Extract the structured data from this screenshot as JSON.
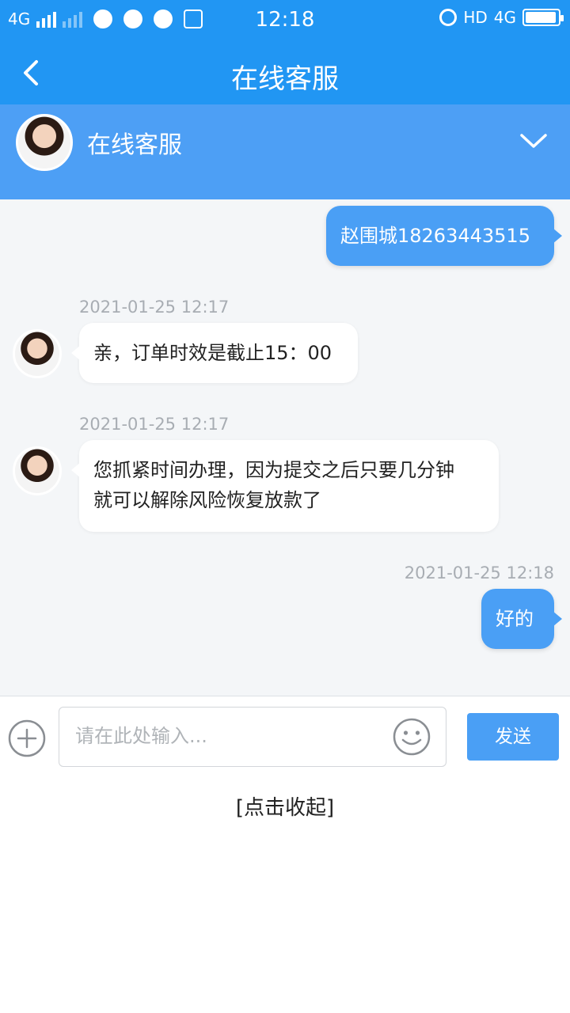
{
  "status_bar": {
    "network_left": "4G",
    "time": "12:18",
    "hd_label": "HD",
    "network_right": "4G",
    "icons": [
      "signal-icon",
      "signal-dim-icon",
      "palette-icon",
      "browser-icon",
      "chat-icon",
      "s-icon",
      "alarm-icon",
      "battery-icon"
    ]
  },
  "title_bar": {
    "title": "在线客服",
    "back_icon": "chevron-left-icon"
  },
  "agent": {
    "name": "在线客服",
    "expand_icon": "chevron-down-icon"
  },
  "messages": [
    {
      "from": "me",
      "text": "赵围城18263443515"
    },
    {
      "from": "agent",
      "timestamp": "2021-01-25 12:17",
      "text": "亲，订单时效是截止15：00"
    },
    {
      "from": "agent",
      "timestamp": "2021-01-25 12:17",
      "lines": [
        "您抓紧时间办理，因为提交之后只要几分钟",
        "就可以解除风险恢复放款了"
      ]
    },
    {
      "from": "me",
      "timestamp": "2021-01-25 12:18",
      "text": "好的"
    }
  ],
  "input": {
    "placeholder": "请在此处输入...",
    "value": "",
    "send_label": "发送",
    "add_icon": "plus-circle-icon",
    "emoji_icon": "smile-icon"
  },
  "collapse_label": "[点击收起]",
  "colors": {
    "primary": "#2196f3",
    "header": "#4d9ff5",
    "bubble_me": "#4a9ff5",
    "chat_bg": "#f4f6f8"
  }
}
